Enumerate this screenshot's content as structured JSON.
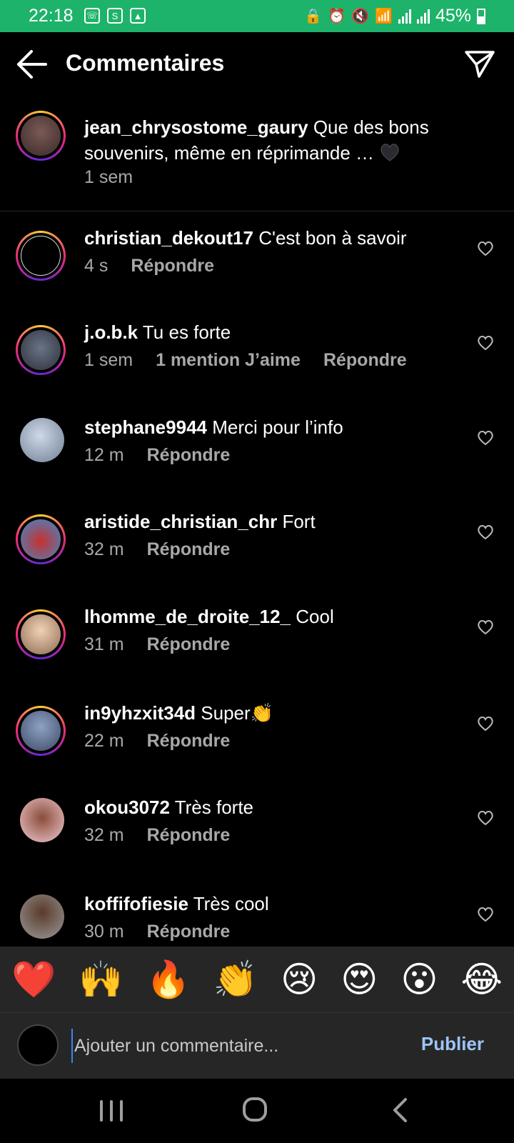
{
  "status_bar": {
    "time": "22:18",
    "battery": "45%"
  },
  "header": {
    "title": "Commentaires"
  },
  "caption": {
    "username": "jean_chrysostome_gaury",
    "text": "Que des bons souvenirs, même en réprimande …",
    "time": "1 sem"
  },
  "comments": [
    {
      "username": "christian_dekout17",
      "text": "C'est bon à savoir",
      "time": "4 s",
      "likes": "",
      "reply": "Répondre"
    },
    {
      "username": "j.o.b.k",
      "text": "Tu es forte",
      "time": "1 sem",
      "likes": "1 mention J’aime",
      "reply": "Répondre"
    },
    {
      "username": "stephane9944",
      "text": "Merci pour l’info",
      "time": "12 m",
      "likes": "",
      "reply": "Répondre"
    },
    {
      "username": "aristide_christian_chr",
      "text": "Fort",
      "time": "32 m",
      "likes": "",
      "reply": "Répondre"
    },
    {
      "username": "lhomme_de_droite_12_",
      "text": "Cool",
      "time": "31 m",
      "likes": "",
      "reply": "Répondre"
    },
    {
      "username": "in9yhzxit34d",
      "text": "Super👏",
      "time": "22 m",
      "likes": "",
      "reply": "Répondre"
    },
    {
      "username": "okou3072",
      "text": "Très forte",
      "time": "32 m",
      "likes": "",
      "reply": "Répondre"
    },
    {
      "username": "koffifofiesie",
      "text": "Très cool",
      "time": "30 m",
      "likes": "",
      "reply": "Répondre"
    }
  ],
  "emoji_reactions": [
    "❤️",
    "🙌",
    "🔥",
    "👏",
    "😢",
    "😍",
    "😮",
    "😂"
  ],
  "comment_input": {
    "placeholder": "Ajouter un commentaire...",
    "publish_label": "Publier"
  },
  "colors": {
    "status_bar": "#1db36a",
    "background": "#000000",
    "publish": "#9cc4f5",
    "secondary_text": "#a8a8a8"
  }
}
